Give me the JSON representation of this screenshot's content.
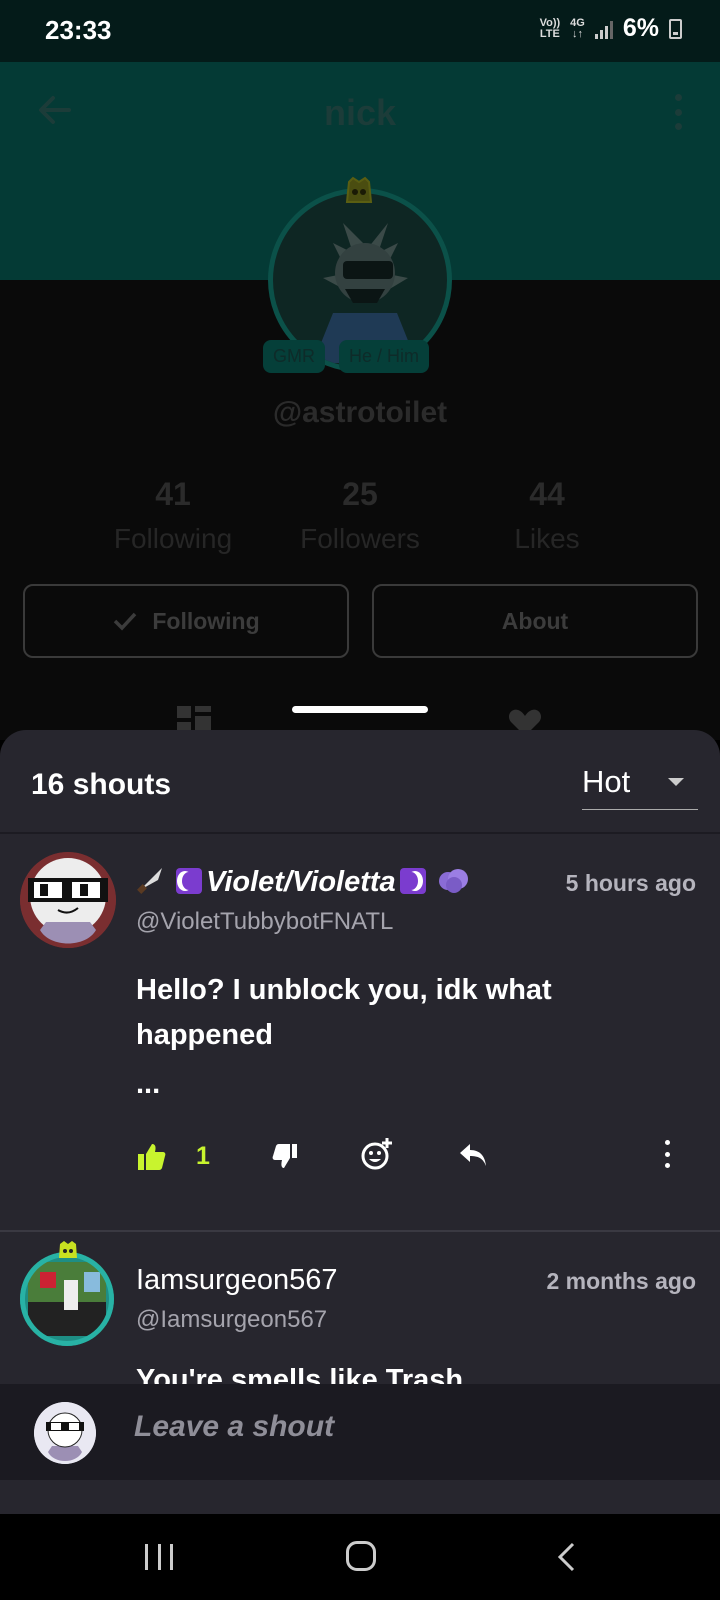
{
  "status_bar": {
    "time": "23:33",
    "network_top": "Vo))",
    "network_bottom": "LTE",
    "network_gen": "4G",
    "battery_percent": "6%",
    "icons": [
      "volte-icon",
      "4g-icon",
      "signal-icon",
      "battery-charging-icon"
    ]
  },
  "profile": {
    "title": "nick",
    "handle": "@astrotoilet",
    "tags": [
      "GMR",
      "He / Him"
    ],
    "stats": [
      {
        "value": "41",
        "label": "Following"
      },
      {
        "value": "25",
        "label": "Followers"
      },
      {
        "value": "44",
        "label": "Likes"
      }
    ],
    "following_button": "Following",
    "about_button": "About",
    "header_color": "#043a35"
  },
  "sheet": {
    "count_label": "16 shouts",
    "sort_value": "Hot"
  },
  "comments": [
    {
      "name": "Violet/Violetta",
      "handle": "@VioletTubbybotFNATL",
      "time": "5 hours ago",
      "text": "Hello? I unblock you, idk what happened",
      "more": "...",
      "likes": "1"
    },
    {
      "name": "Iamsurgeon567",
      "handle": "@Iamsurgeon567",
      "time": "2 months ago",
      "text": "You're smells like Trash"
    }
  ],
  "compose": {
    "placeholder": "Leave a shout"
  },
  "colors": {
    "sheet_bg": "#27262e",
    "like_accent": "#c8f42e",
    "teal": "#043a35"
  }
}
